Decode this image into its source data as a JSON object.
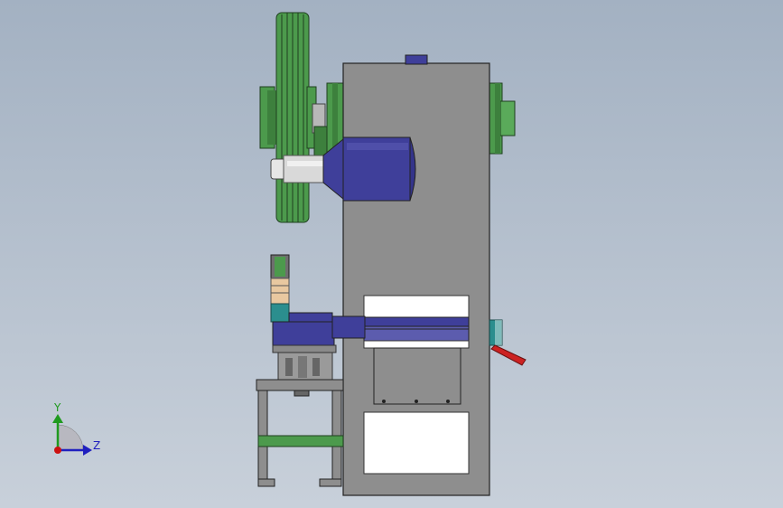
{
  "viewport": {
    "background_top": "#a3b1c2",
    "background_bottom": "#c8d0da"
  },
  "model": {
    "frame_color": "#8e8e8e",
    "flywheel_color": "#4c9a4c",
    "motor_color": "#3f3f9a",
    "belt_color": "#4f8f4f",
    "accent_red": "#cc2222",
    "accent_teal": "#2b8e8e"
  },
  "axes_triad": {
    "y_label": "Y",
    "z_label": "Z",
    "y_color": "#1f9a1f",
    "z_color": "#1f1fbf",
    "origin_color": "#cc1111"
  }
}
